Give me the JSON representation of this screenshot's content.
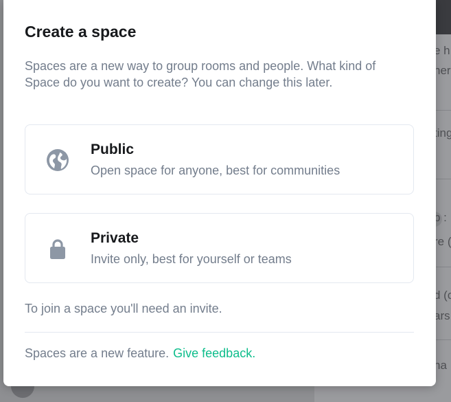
{
  "dialog": {
    "title": "Create a space",
    "description": "Spaces are a new way to group rooms and people. What kind of Space do you want to create? You can change this later.",
    "options": [
      {
        "label": "Public",
        "description": "Open space for anyone, best for communities",
        "icon": "globe-icon"
      },
      {
        "label": "Private",
        "description": "Invite only, best for yourself or teams",
        "icon": "lock-icon"
      }
    ],
    "invite_note": "To join a space you'll need an invite.",
    "footer_text": "Spaces are a new feature.",
    "feedback_link": "Give feedback."
  },
  "background": {
    "fragments": [
      "e h",
      "her",
      "ting",
      "b :",
      "re (",
      "d (c",
      "ars",
      "ha"
    ]
  },
  "colors": {
    "accent": "#0dbd8b",
    "text_primary": "#17191c",
    "text_secondary": "#737d8c",
    "border": "#e3e8f0",
    "icon": "#8d97a5"
  }
}
